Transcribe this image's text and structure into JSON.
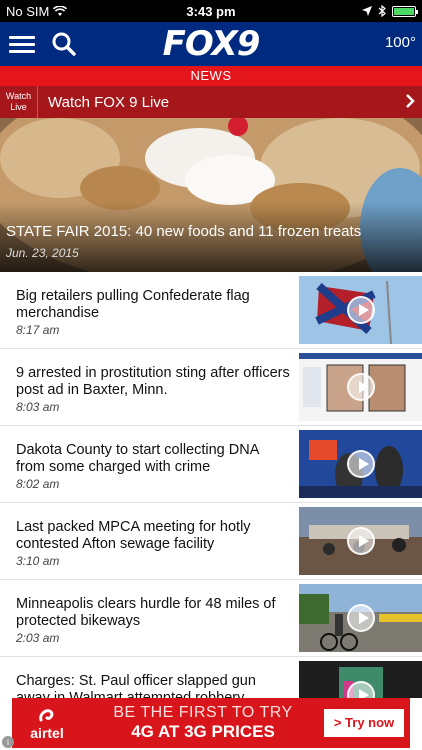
{
  "status_bar": {
    "carrier": "No SIM",
    "time": "3:43 pm"
  },
  "header": {
    "logo": "FOX9",
    "temperature": "100°",
    "icons": [
      "menu-icon",
      "search-icon"
    ]
  },
  "section": {
    "label": "NEWS"
  },
  "watch_live": {
    "tag_line1": "Watch",
    "tag_line2": "Live",
    "label": "Watch FOX 9 Live"
  },
  "hero": {
    "title": "STATE FAIR 2015: 40 new foods and 11 frozen treats",
    "date": "Jun. 23, 2015"
  },
  "stories": [
    {
      "title": "Big retailers pulling Confederate flag merchandise",
      "time": "8:17 am"
    },
    {
      "title": "9 arrested in prostitution sting after officers post ad in Baxter, Minn.",
      "time": "8:03 am"
    },
    {
      "title": "Dakota County to start collecting DNA from some charged with crime",
      "time": "8:02 am"
    },
    {
      "title": "Last packed MPCA meeting for hotly contested Afton sewage facility",
      "time": "3:10 am"
    },
    {
      "title": "Minneapolis clears hurdle for 48 miles of protected bikeways",
      "time": "2:03 am"
    },
    {
      "title": "Charges: St. Paul officer slapped gun away in Walmart attempted robbery",
      "time": ""
    }
  ],
  "ad": {
    "brand": "airtel",
    "line1": "BE THE FIRST TO TRY",
    "line2": "4G AT 3G PRICES",
    "cta": "> Try now"
  },
  "colors": {
    "header_bg": "#002a80",
    "news_red": "#e5161b",
    "watch_bar": "#a5171b",
    "ad_red": "#d8151b"
  }
}
